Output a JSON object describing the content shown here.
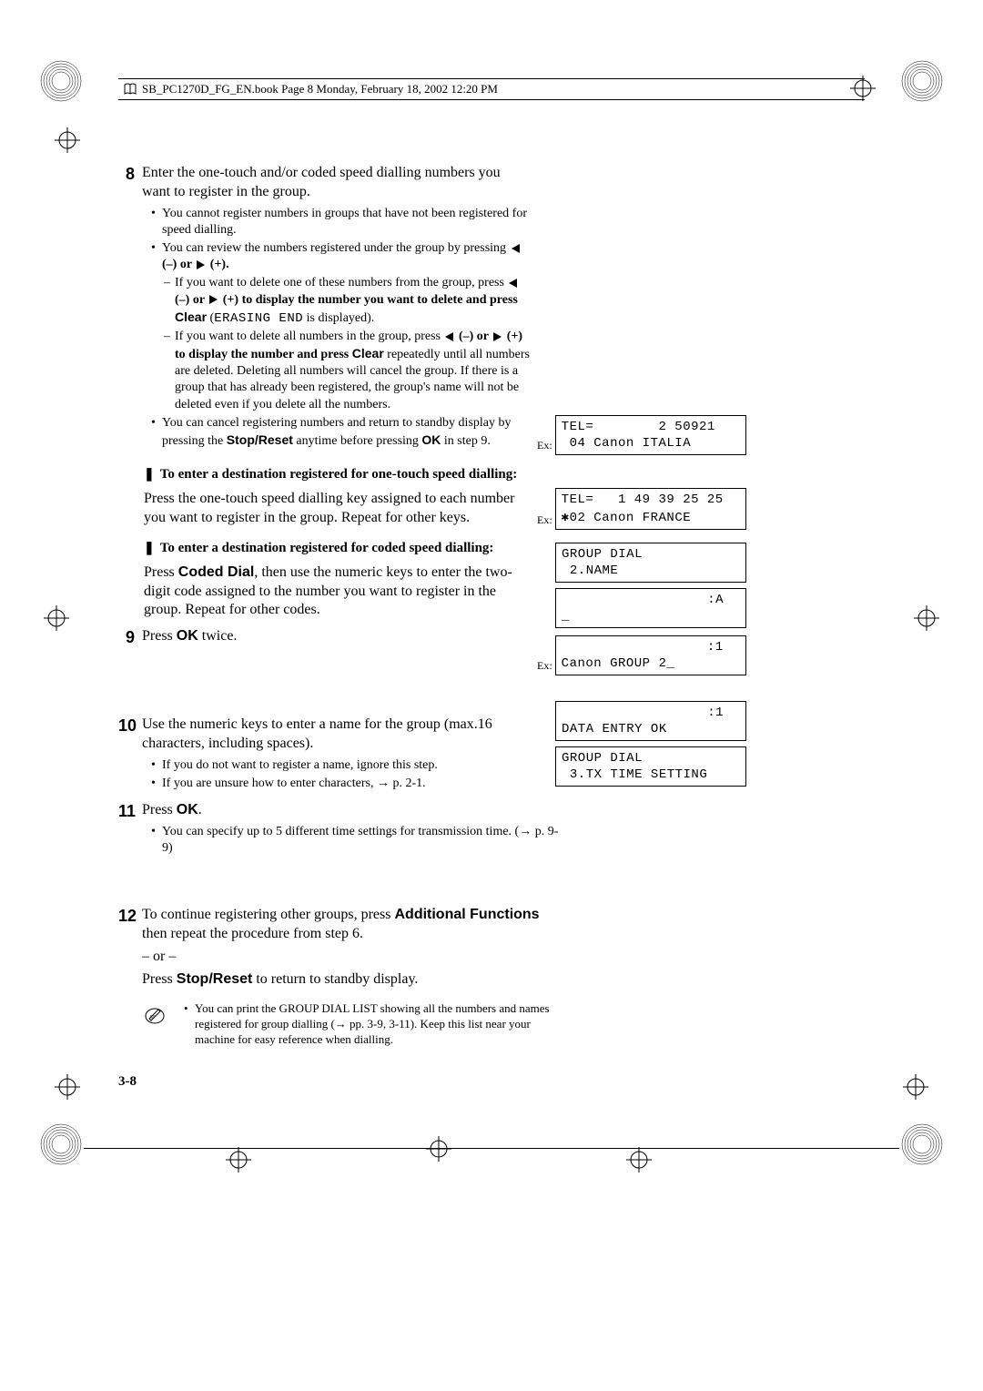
{
  "header": {
    "runningHead": "SB_PC1270D_FG_EN.book  Page 8  Monday, February 18, 2002  12:20 PM"
  },
  "steps": {
    "s8": {
      "num": "8",
      "text": "Enter the one-touch and/or coded speed dialling numbers you want to register in the group.",
      "b1": "You cannot register numbers in groups that have not been registered for speed dialling.",
      "b2a": "You can review the numbers registered under the group by pressing ",
      "b2b": " (–) or ",
      "b2c": " (+).",
      "d1a": "If you want to delete one of these numbers from the group, press ",
      "d1b": " (–) or ",
      "d1c": " (+) to display the number you want to delete and press ",
      "d1clear": "Clear",
      "d1d": " (",
      "d1mono": "ERASING END",
      "d1e": " is displayed).",
      "d2a": "If you want to delete all numbers in the group, press ",
      "d2b": " (–) or ",
      "d2c": " (+) to display the number and press ",
      "d2clear": "Clear",
      "d2d": " repeatedly until all numbers are deleted. Deleting all numbers will cancel the group. If there is a group that has already been registered, the group's name will not be deleted even if you delete all the numbers.",
      "b3a": "You can cancel registering numbers and return to standby display by pressing the ",
      "b3stop": "Stop/Reset",
      "b3b": " anytime before pressing ",
      "b3ok": "OK",
      "b3c": " in step 9."
    },
    "sub1": {
      "heading": "To enter a destination registered for one-touch speed dialling:",
      "para": "Press the one-touch speed dialling key assigned to each number you want to register in the group. Repeat for other keys."
    },
    "sub2": {
      "heading": "To enter a destination registered for coded speed dialling:",
      "para_a": "Press ",
      "para_bold": "Coded Dial",
      "para_b": ", then use the numeric keys to enter the two-digit code assigned to the number you want to register in the group. Repeat for other codes."
    },
    "s9": {
      "num": "9",
      "text_a": "Press ",
      "text_ok": "OK",
      "text_b": " twice."
    },
    "s10": {
      "num": "10",
      "text": "Use the numeric keys to enter a name for the group (max.16 characters, including spaces).",
      "b1": "If you do not want to register a name, ignore this step.",
      "b2a": "If you are unsure how to enter characters, ",
      "b2arrow": "→",
      "b2b": " p. 2-1."
    },
    "s11": {
      "num": "11",
      "text_a": "Press ",
      "text_ok": "OK",
      "text_b": ".",
      "b1a": "You can specify up to 5 different time settings for transmission time. (",
      "b1arrow": "→",
      "b1b": " p. 9-9)"
    },
    "s12": {
      "num": "12",
      "text_a": "To continue registering other groups, press ",
      "text_bold": "Additional Functions",
      "text_b": " then repeat the procedure from step 6.",
      "or": "– or –",
      "text_c": "Press ",
      "text_bold2": "Stop/Reset",
      "text_d": " to return to standby display."
    },
    "note": {
      "b1a": "You can print the GROUP DIAL LIST showing all the numbers and names registered for group dialling (",
      "b1arrow": "→",
      "b1b": " pp. 3-9, 3-11). Keep this list near your machine for easy reference when dialling."
    }
  },
  "lcd": {
    "ex": "Ex:",
    "d1l1": "TEL=        2 50921",
    "d1l2": " 04 Canon ITALIA",
    "d2l1": "TEL=   1 49 39 25 25",
    "d2l2": "✱02 Canon FRANCE",
    "d3l1": "GROUP DIAL",
    "d3l2": " 2.NAME",
    "d4l1": "                  :A",
    "d4l2": "_",
    "d5l1": "                  :1",
    "d5l2": "Canon GROUP 2_",
    "d6l1": "                  :1",
    "d6l2": "DATA ENTRY OK",
    "d7l1": "GROUP DIAL",
    "d7l2": " 3.TX TIME SETTING"
  },
  "pageNumber": "3-8"
}
